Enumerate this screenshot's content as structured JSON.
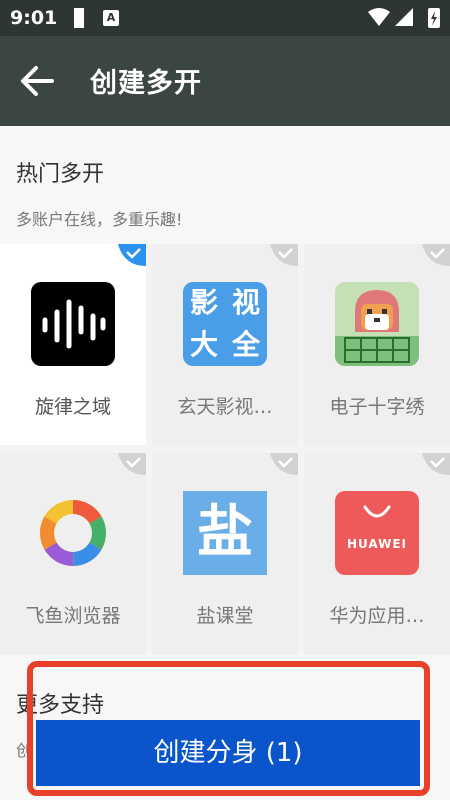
{
  "status_bar": {
    "time": "9:01",
    "notif_letter": "A"
  },
  "app_bar": {
    "title": "创建多开"
  },
  "hot_section": {
    "title": "热门多开",
    "subtitle": "多账户在线，多重乐趣!"
  },
  "apps": [
    {
      "label": "旋律之域",
      "selected": true,
      "icon": "sound-wave-icon"
    },
    {
      "label": "玄天影视…",
      "selected": false,
      "icon": "video-app-icon",
      "icon_text": [
        "影",
        "视",
        "大",
        "全"
      ]
    },
    {
      "label": "电子十字绣",
      "selected": false,
      "icon": "shiba-dog-icon"
    },
    {
      "label": "飞鱼浏览器",
      "selected": false,
      "icon": "aperture-icon"
    },
    {
      "label": "盐课堂",
      "selected": false,
      "icon": "salt-character-icon",
      "icon_text": "盐"
    },
    {
      "label": "华为应用…",
      "selected": false,
      "icon": "huawei-bag-icon",
      "icon_text": "HUAWEI"
    }
  ],
  "more_section": {
    "title": "更多支持",
    "subtitle": "创"
  },
  "create_button": {
    "label": "创建分身 (1)"
  },
  "colors": {
    "accent": "#0a55cc",
    "check_selected": "#2b93ee",
    "annotation_red": "#e8402a",
    "app_bar": "#3b4542"
  }
}
